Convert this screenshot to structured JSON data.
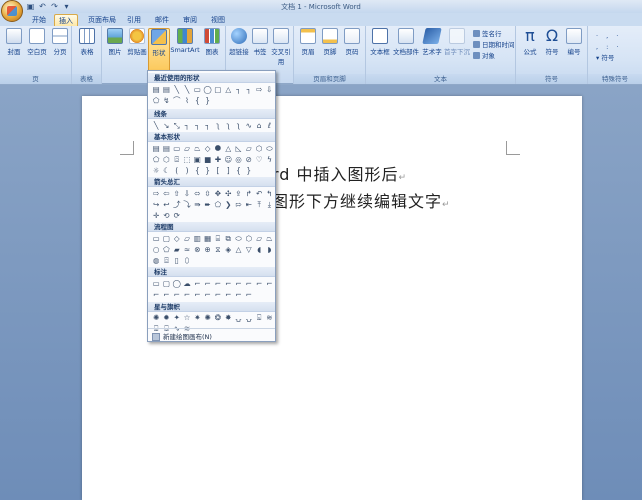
{
  "window": {
    "title": "文档 1 - Microsoft Word"
  },
  "qat": {
    "icons": [
      "save-icon",
      "undo-icon",
      "redo-icon",
      "customize-icon"
    ],
    "glyphs": [
      "▣",
      "↶",
      "↷",
      "▾"
    ]
  },
  "tabs": [
    "开始",
    "插入",
    "页面布局",
    "引用",
    "邮件",
    "审阅",
    "视图"
  ],
  "ribbon": {
    "groups": {
      "pages": "页",
      "tables": "表格",
      "headerfooter": "页眉和页脚",
      "text": "文本",
      "symbols": "符号",
      "special": "特殊符号"
    },
    "buttons": {
      "cover": "封面",
      "blank": "空白页",
      "pagebreak": "分页",
      "table": "表格",
      "picture": "图片",
      "clipart": "剪贴画",
      "shapes": "形状",
      "smartart": "SmartArt",
      "chart": "图表",
      "hyperlink": "超链接",
      "bookmark": "书签",
      "crossref": "交叉引用",
      "header": "页眉",
      "footer": "页脚",
      "pagenum": "页码",
      "textbox": "文本框",
      "quickparts": "文档部件",
      "wordart": "艺术字",
      "dropcap": "首字下沉",
      "equation": "公式",
      "symbol": "符号",
      "numbering": "编号",
      "symbol_small": "符号"
    },
    "small": {
      "signature": "签名行",
      "datetime": "日期和时间",
      "object": "对象"
    }
  },
  "document": {
    "line1": "rd 中插入图形后",
    "line2": "图形下方继续编辑文字"
  },
  "shapes_menu": {
    "sections": {
      "recent": "最近使用的形状",
      "lines": "线条",
      "basic": "基本形状",
      "arrows": "箭头总汇",
      "flowchart": "流程图",
      "callouts": "标注",
      "stars": "星与旗帜"
    },
    "new_canvas": "新建绘图画布(N)"
  }
}
